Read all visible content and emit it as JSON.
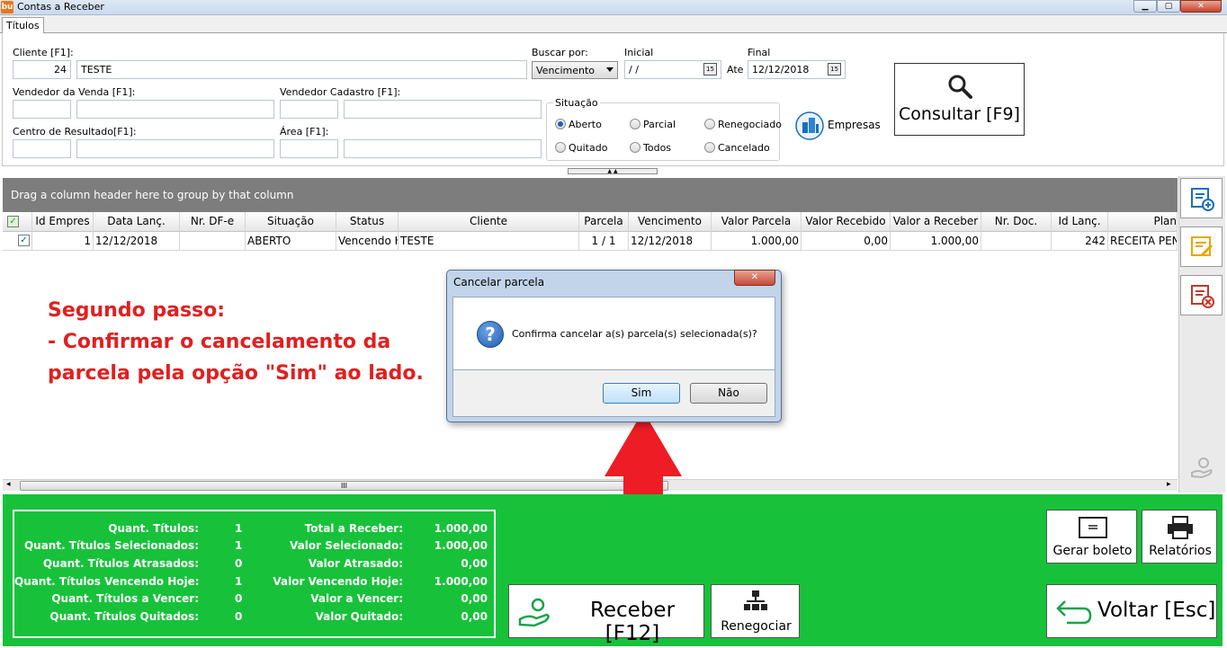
{
  "window": {
    "title": "Contas a Receber",
    "app_icon_text": "bu",
    "min": "▁",
    "max": "▢",
    "close": "✕"
  },
  "tabs": [
    "Títulos"
  ],
  "filters": {
    "cliente_label": "Cliente [F1]:",
    "cliente_code": "24",
    "cliente_name": "TESTE",
    "buscar_por_label": "Buscar por:",
    "buscar_por_value": "Vencimento",
    "inicial_label": "Inicial",
    "inicial_value": " / /",
    "ate_label": "Ate",
    "final_label": "Final",
    "final_value": "12/12/2018",
    "cal_glyph": "15",
    "vendedor_venda_label": "Vendedor da Venda [F1]:",
    "vendedor_cadastro_label": "Vendedor Cadastro [F1]:",
    "centro_resultado_label": "Centro de Resultado[F1]:",
    "area_label": "Área [F1]:",
    "situacao_label": "Situação",
    "situacao_options": [
      "Aberto",
      "Parcial",
      "Renegociado",
      "Quitado",
      "Todos",
      "Cancelado"
    ],
    "situacao_selected": "Aberto",
    "empresas_label": "Empresas",
    "consultar_label": "Consultar [F9]"
  },
  "grid": {
    "group_hint": "Drag a column header here to group by that column",
    "columns": [
      "Id Empres",
      "Data Lanç.",
      "Nr. DF-e",
      "Situação",
      "Status",
      "Cliente",
      "Parcela",
      "Vencimento",
      "Valor Parcela",
      "Valor Recebido",
      "Valor a Receber",
      "Nr. Doc.",
      "Id Lanç.",
      "Plan"
    ],
    "rows": [
      [
        "1",
        "12/12/2018",
        "",
        "ABERTO",
        "Vencendo H",
        "TESTE",
        "1 / 1",
        "12/12/2018",
        "1.000,00",
        "0,00",
        "1.000,00",
        "",
        "242",
        "RECEITA PEN"
      ]
    ],
    "scroll_thumb": "III",
    "scroll_left": "◂",
    "scroll_right": "▸"
  },
  "annotation": {
    "line1": "Segundo passo:",
    "line2": "- Confirmar o cancelamento da",
    "line3": "parcela pela opção \"Sim\" ao lado."
  },
  "dialog": {
    "title": "Cancelar parcela",
    "icon": "?",
    "message": "Confirma cancelar a(s) parcela(s) selecionada(s)?",
    "yes_label": "Sim",
    "no_label": "Não",
    "close": "✕"
  },
  "summary": {
    "left": [
      {
        "label": "Quant. Títulos:",
        "value": "1"
      },
      {
        "label": "Quant. Títulos Selecionados:",
        "value": "1"
      },
      {
        "label": "Quant. Títulos Atrasados:",
        "value": "0"
      },
      {
        "label": "Quant. Títulos Vencendo Hoje:",
        "value": "1"
      },
      {
        "label": "Quant. Títulos a Vencer:",
        "value": "0"
      },
      {
        "label": "Quant. Títulos Quitados:",
        "value": "0"
      }
    ],
    "right": [
      {
        "label": "Total a Receber:",
        "value": "1.000,00"
      },
      {
        "label": "Valor Selecionado:",
        "value": "1.000,00"
      },
      {
        "label": "Valor Atrasado:",
        "value": "0,00"
      },
      {
        "label": "Valor Vencendo Hoje:",
        "value": "1.000,00"
      },
      {
        "label": "Valor a Vencer:",
        "value": "0,00"
      },
      {
        "label": "Valor Quitado:",
        "value": "0,00"
      }
    ]
  },
  "buttons": {
    "receber": "Receber [F12]",
    "renegociar": "Renegociar",
    "gerar_boleto": "Gerar boleto",
    "relatorios": "Relatórios",
    "voltar": "Voltar [Esc]"
  },
  "colors": {
    "bottom_panel": "#17c23a",
    "annotation": "#e02020",
    "arrow": "#ee1c24",
    "group_panel": "#7d7d7d"
  }
}
